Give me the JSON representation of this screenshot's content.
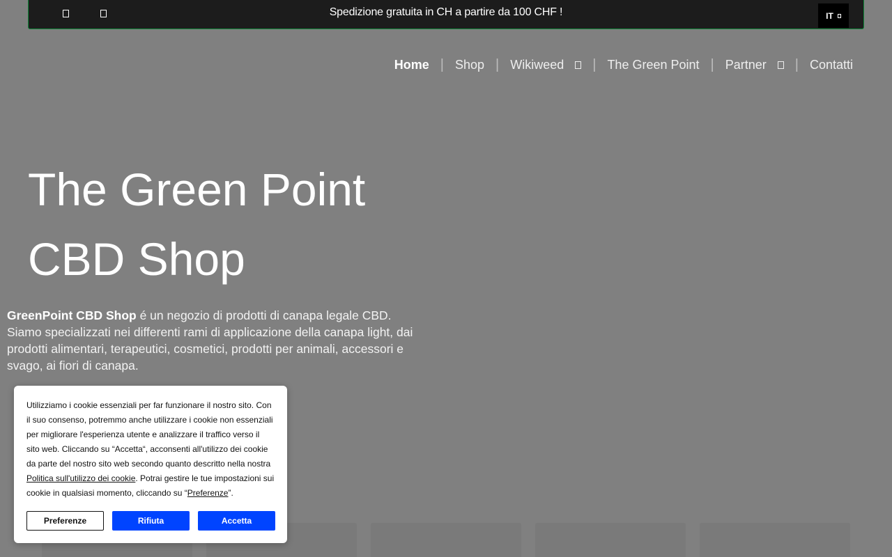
{
  "topbar": {
    "promo_text": "Spedizione gratuita in CH a partire da 100 CHF !",
    "left_icons": [
      "square-icon",
      "square-icon"
    ],
    "language": "IT",
    "border_color": "#0f8a3a"
  },
  "nav": {
    "items": [
      {
        "label": "Home",
        "active": true
      },
      {
        "label": "Shop"
      },
      {
        "label": "Wikiweed",
        "dropdown": true
      },
      {
        "label": "The Green Point"
      },
      {
        "label": "Partner",
        "dropdown": true
      },
      {
        "label": "Contatti"
      }
    ],
    "separator": "|"
  },
  "hero": {
    "title_line1": "The Green Point",
    "title_line2": "CBD Shop"
  },
  "intro": {
    "brand": "GreenPoint CBD Shop",
    "text": " é un negozio di prodotti di canapa legale CBD. Siamo specializzati nei differenti rami di applicazione della canapa light, dai prodotti alimentari, terapeutici, cosmetici, prodotti per animali, accessori e svago, ai fiori di canapa."
  },
  "cookie": {
    "text_part1": "Utilizziamo i cookie essenziali per far funzionare il nostro sito. Con il suo consenso, potremmo anche utilizzare i cookie non essenziali per migliorare l'esperienza utente e analizzare il traffico verso il sito web. Cliccando su “Accetta“, acconsenti all'utilizzo dei cookie da parte del nostro sito web secondo quanto descritto nella nostra ",
    "policy_link": "Politica sull'utilizzo dei cookie",
    "text_part2": ". Potrai gestire le tue impostazioni sui cookie in qualsiasi momento, cliccando su “",
    "preferences_link": "Preferenze",
    "text_part3": "”.",
    "buttons": {
      "preferences": "Preferenze",
      "reject": "Rifiuta",
      "accept": "Accetta"
    },
    "accent_color": "#0044ff"
  }
}
